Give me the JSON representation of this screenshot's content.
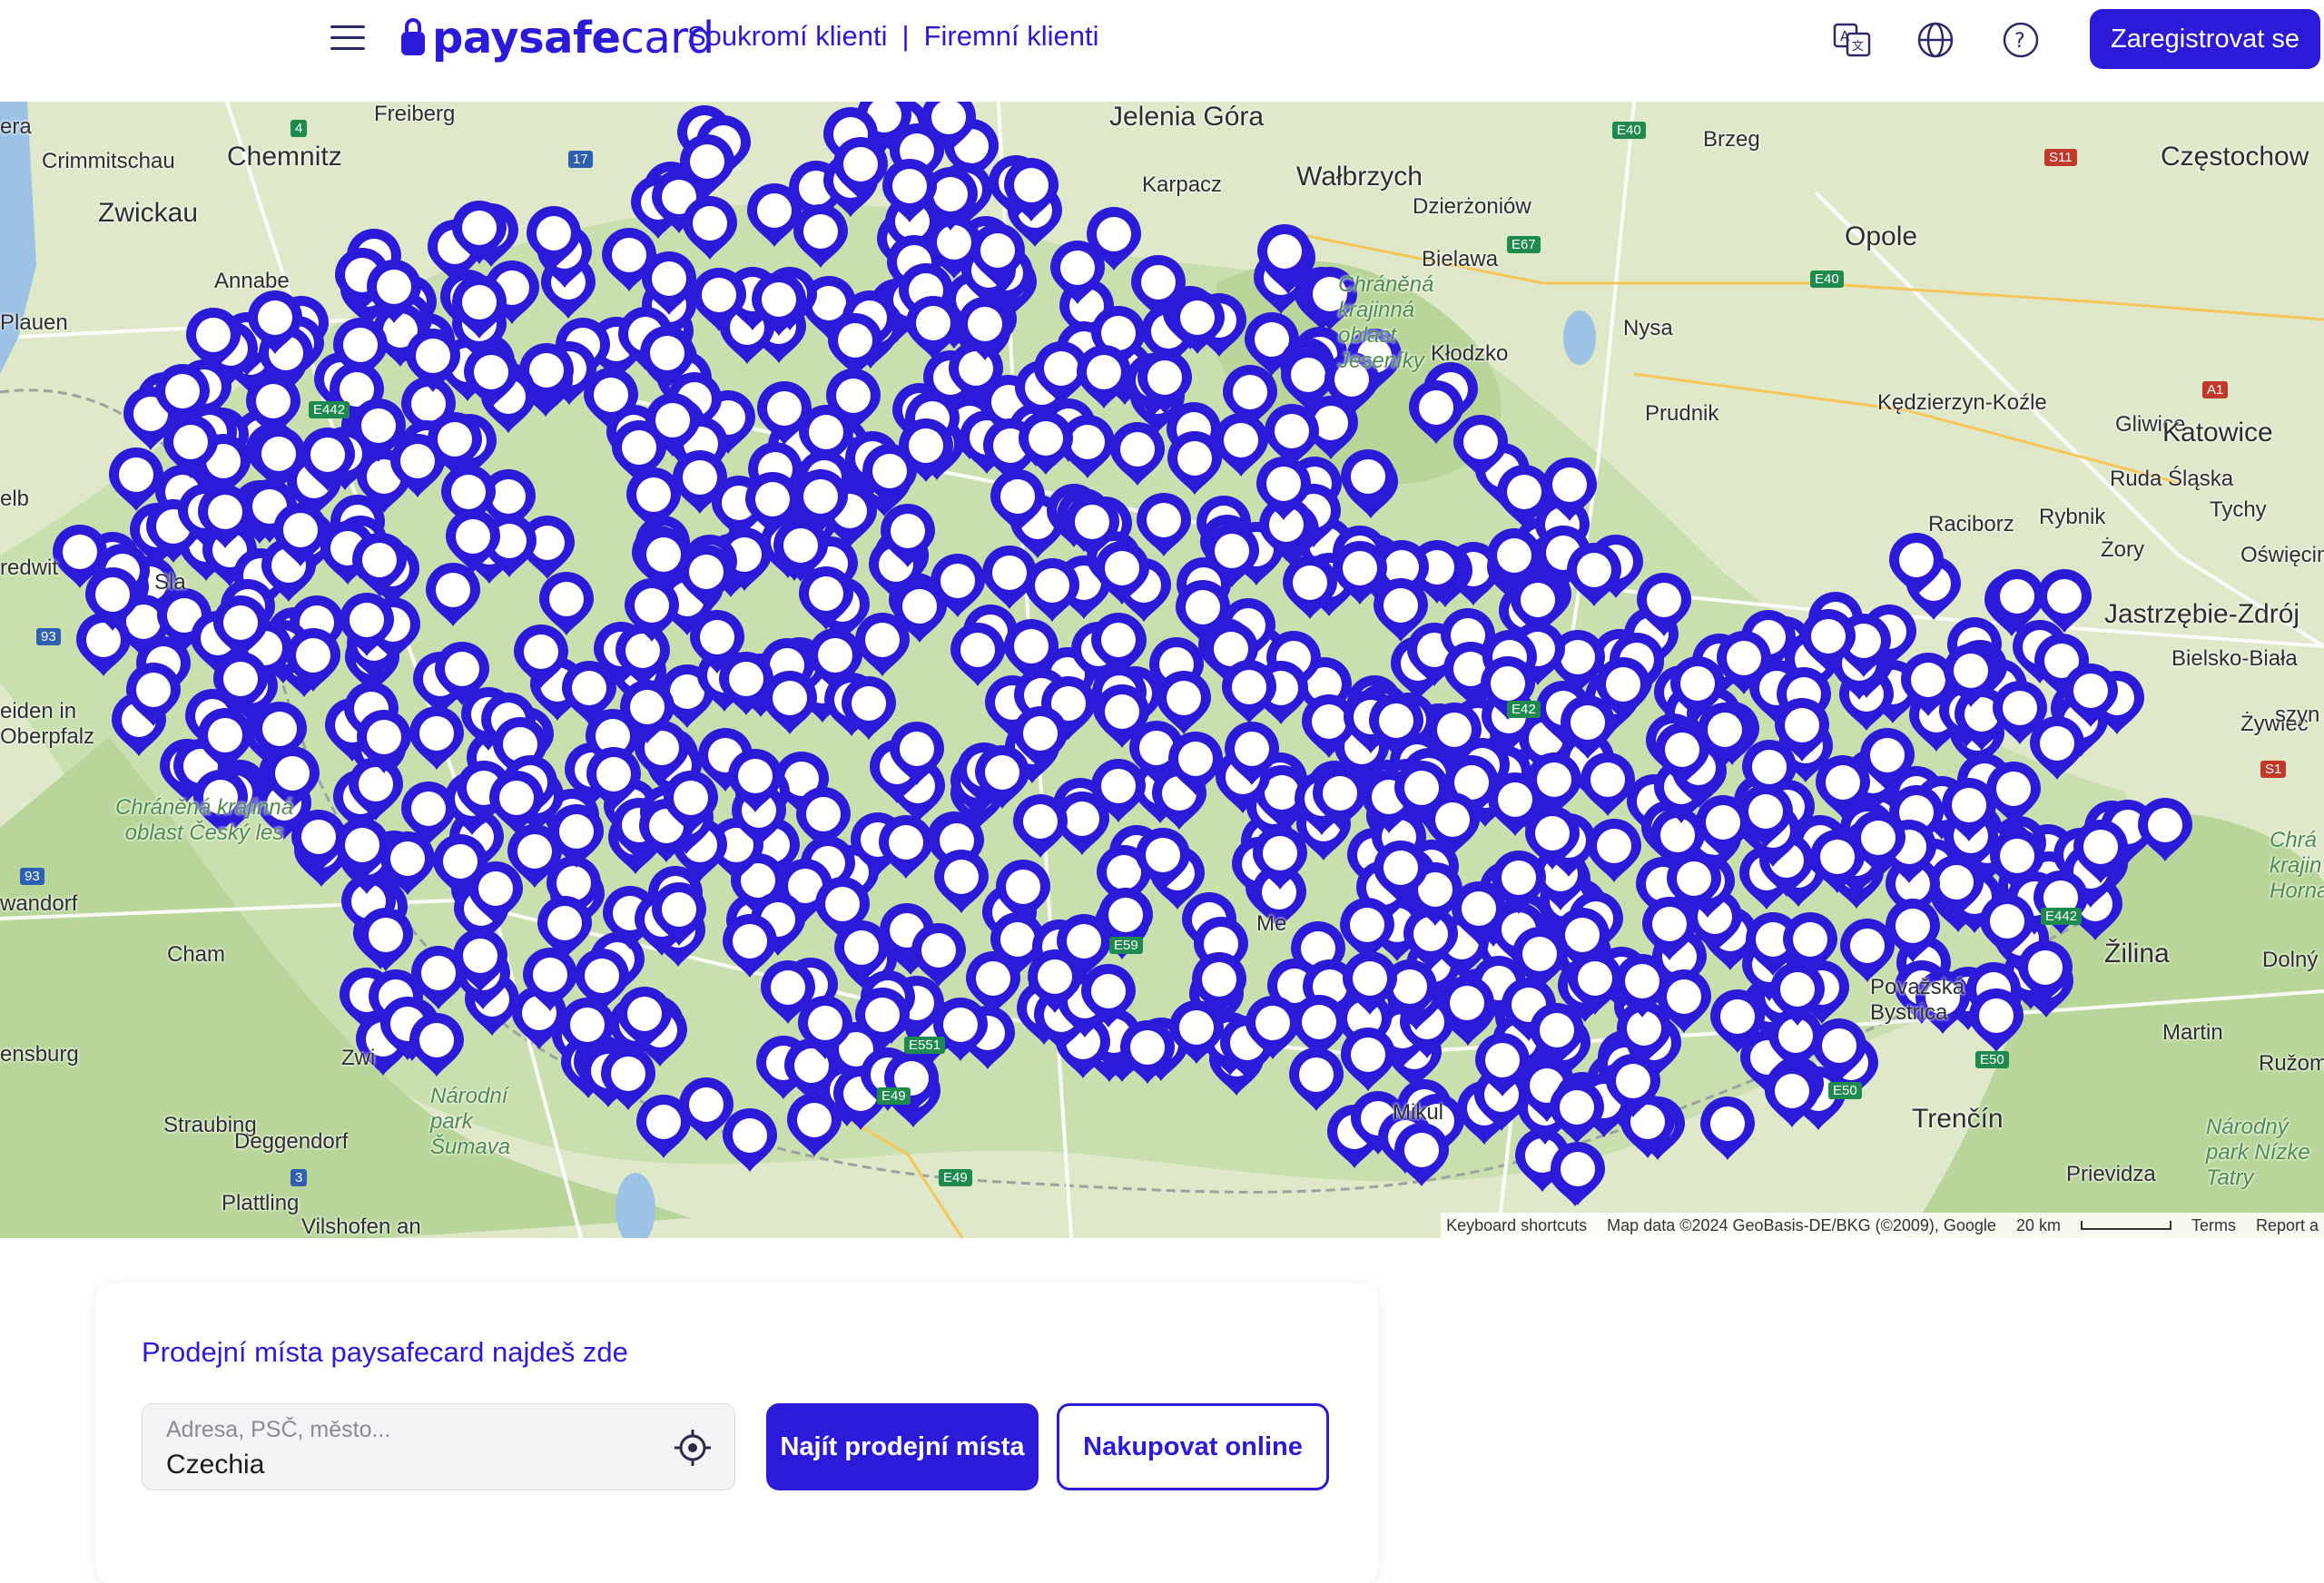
{
  "header": {
    "logo_bold": "paysafe",
    "logo_light": "card",
    "nav_private": "Soukromí klienti",
    "nav_separator": "|",
    "nav_business": "Firemní klienti",
    "register_label": "Zaregistrovat se",
    "icons": [
      "translate-icon",
      "globe-icon",
      "help-icon"
    ]
  },
  "map": {
    "cities": [
      "Chemnitz",
      "Zwickau",
      "Freiberg",
      "Crimmitschau",
      "Annabe",
      "Plauen",
      "era",
      "Jelenia Góra",
      "Wałbrzych",
      "Karpacz",
      "Dzierżoniów",
      "Bielawa",
      "Kłodzko",
      "Brzeg",
      "Opole",
      "Częstochow",
      "Nysa",
      "Prudnik",
      "Kędzierzyn-Koźle",
      "Gliwice",
      "Katowice",
      "Ruda Śląska",
      "Tychy",
      "Raciborz",
      "Rybnik",
      "Żory",
      "Oświęcim",
      "Jastrzębie-Zdrój",
      "Bielsko-Biała",
      "Żywiec",
      "Žilina",
      "Dolný K",
      "Považská Bystrica",
      "Martin",
      "Ružom",
      "Trenčín",
      "Prievidza",
      "eiden in Oberpfalz",
      "Cham",
      "ensburg",
      "Straubing",
      "Deggendorf",
      "Plattling",
      "Vilshofen an",
      "wandorf",
      "Zwi",
      "Sla",
      "Me",
      "Mikul",
      "redwit",
      "elb",
      "szyn"
    ],
    "parks": [
      "Chráněná krajinná oblast Český les",
      "Národní park Šumava",
      "Chráněná krajinná oblast Jeseníky",
      "Národný park Nízke Tatry",
      "Chrá krajin Horna"
    ],
    "roads": [
      "4",
      "17",
      "E40",
      "E67",
      "E40",
      "S11",
      "A1",
      "E442",
      "93",
      "93",
      "3",
      "E442",
      "E50",
      "E50",
      "E49",
      "E49",
      "E551",
      "E59",
      "E42",
      "S1"
    ],
    "attribution": {
      "shortcuts": "Keyboard shortcuts",
      "data": "Map data ©2024 GeoBasis-DE/BKG (©2009), Google",
      "scale": "20 km",
      "terms": "Terms",
      "report": "Report a"
    },
    "marker_color": "#2b1bd9",
    "marker_count_visible": "many"
  },
  "search": {
    "title": "Prodejní místa paysafecard najdeš zde",
    "placeholder": "Adresa, PSČ, město...",
    "value": "Czechia",
    "find_button": "Najít prodejní místa",
    "online_button": "Nakupovat online"
  },
  "colors": {
    "brand": "#2b1bd9",
    "map_land": "#dfe8c9",
    "map_forest": "#b9d69a"
  }
}
